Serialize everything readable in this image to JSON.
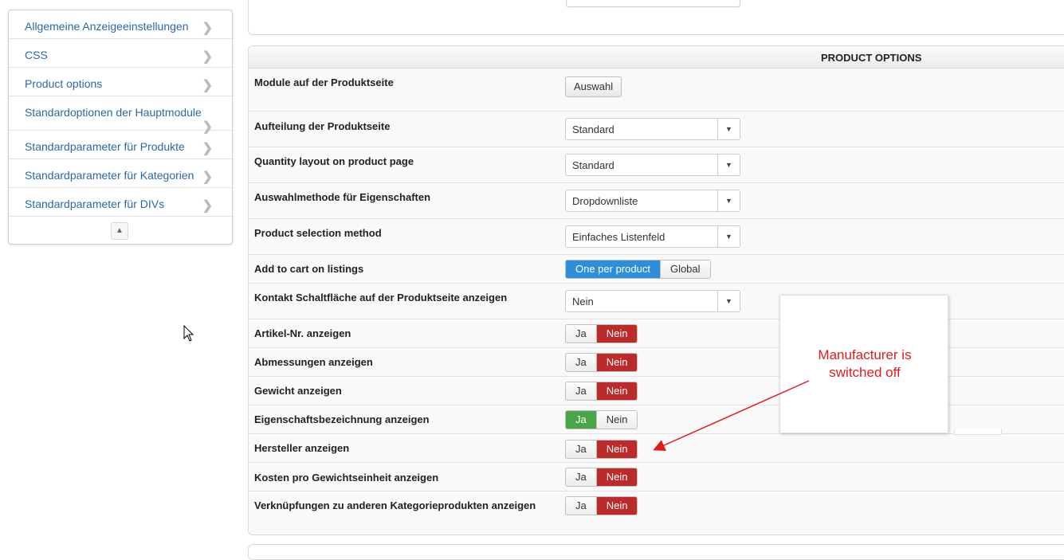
{
  "sidebar": {
    "items": [
      {
        "label": "Allgemeine Anzeigeeinstellungen"
      },
      {
        "label": "CSS"
      },
      {
        "label": "Product options"
      },
      {
        "label": "Standardoptionen der Hauptmodule"
      },
      {
        "label": "Standardparameter für Produkte"
      },
      {
        "label": "Standardparameter für Kategorien"
      },
      {
        "label": "Standardparameter für DIVs"
      }
    ],
    "chevron_icon": "chevron-right-icon",
    "collapse_icon": "collapse-up-icon"
  },
  "panel": {
    "title": "PRODUCT OPTIONS",
    "rows": [
      {
        "label": "Module auf der Produktseite",
        "button": "Auswahl"
      },
      {
        "label": "Aufteilung der Produktseite",
        "value": "Standard"
      },
      {
        "label": "Quantity layout on product page",
        "value": "Standard"
      },
      {
        "label": "Auswahlmethode für Eigenschaften",
        "value": "Dropdownliste"
      },
      {
        "label": "Product selection method",
        "value": "Einfaches Listenfeld"
      },
      {
        "label": "Add to cart on listings",
        "opt1": "One per product",
        "opt2": "Global",
        "selected": "One per product"
      },
      {
        "label": "Kontakt Schaltfläche auf der Produktseite anzeigen",
        "value": "Nein"
      },
      {
        "label": "Artikel-Nr. anzeigen",
        "yes": "Ja",
        "no": "Nein",
        "selected": "Nein"
      },
      {
        "label": "Abmessungen anzeigen",
        "yes": "Ja",
        "no": "Nein",
        "selected": "Nein"
      },
      {
        "label": "Gewicht anzeigen",
        "yes": "Ja",
        "no": "Nein",
        "selected": "Nein"
      },
      {
        "label": "Eigenschaftsbezeichnung anzeigen",
        "yes": "Ja",
        "no": "Nein",
        "selected": "Ja"
      },
      {
        "label": "Hersteller anzeigen",
        "yes": "Ja",
        "no": "Nein",
        "selected": "Nein"
      },
      {
        "label": "Kosten pro Gewichtseinheit anzeigen",
        "yes": "Ja",
        "no": "Nein",
        "selected": "Nein"
      },
      {
        "label": "Verknüpfungen zu anderen Kategorieprodukten anzeigen",
        "yes": "Ja",
        "no": "Nein",
        "selected": "Nein"
      }
    ]
  },
  "annotation": {
    "text_line1": "Manufacturer is",
    "text_line2": "switched off",
    "color": "#e11b1b"
  },
  "colors": {
    "link": "#2a69a5",
    "active_blue": "#2d8fdc",
    "active_red": "#bd2a2a",
    "active_green": "#4aa44a"
  }
}
